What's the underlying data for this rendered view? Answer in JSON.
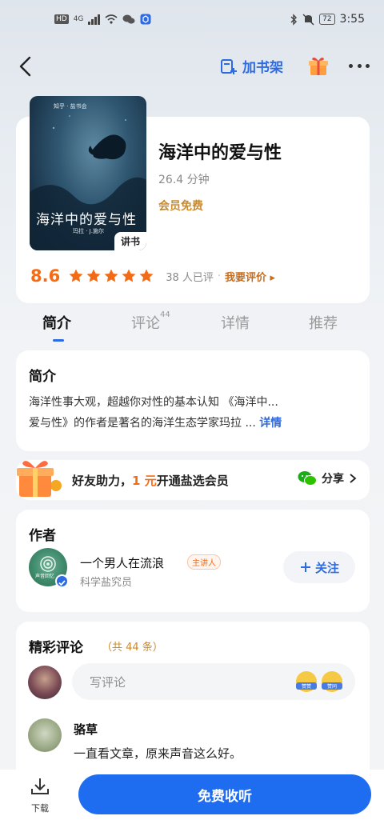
{
  "status_bar": {
    "left_chip": "HD",
    "network": "4G",
    "battery": "72",
    "time": "3:55"
  },
  "nav": {
    "add_shelf_label": "加书架"
  },
  "book": {
    "cover_brand": "知乎 · 盐书会",
    "cover_title": "海洋中的爱与性",
    "cover_author": "玛拉 · J.施尔",
    "cover_tag": "讲书",
    "title": "海洋中的爱与性",
    "duration": "26.4 分钟",
    "member_label": "会员免费",
    "score": "8.6",
    "stars": 5,
    "rated_count": "38 人已评",
    "rate_link": "我要评价 ▸"
  },
  "tabs": [
    {
      "label": "简介",
      "active": true
    },
    {
      "label": "评论",
      "count": "44"
    },
    {
      "label": "详情"
    },
    {
      "label": "推荐"
    }
  ],
  "intro": {
    "heading": "简介",
    "line1": "海洋性事大观，超越你对性的基本认知 《海洋中...",
    "line2": "爱与性》的作者是著名的海洋生态学家玛拉 ...",
    "more": "详情"
  },
  "promo": {
    "text_prefix": "好友助力，",
    "text_highlight": "1 元",
    "text_suffix": "开通盐选会员",
    "share_label": "分享"
  },
  "author": {
    "heading": "作者",
    "avatar_label": "声音回忆",
    "name": "一个男人在流浪",
    "tag": "主讲人",
    "role": "科学盐究员",
    "follow_label": "关注"
  },
  "comments": {
    "heading": "精彩评论",
    "count": "（共 44 条）",
    "placeholder": "写评论",
    "emoji1_label": "赞赞",
    "emoji2_label": "赞同",
    "first": {
      "name": "骆草",
      "text": "一直看文章，原来声音这么好。"
    }
  },
  "bottom": {
    "download_label": "下载",
    "listen_label": "免费收听"
  },
  "colors": {
    "accent": "#2d6be4",
    "orange": "#f46b15",
    "gold": "#c78a2e"
  }
}
